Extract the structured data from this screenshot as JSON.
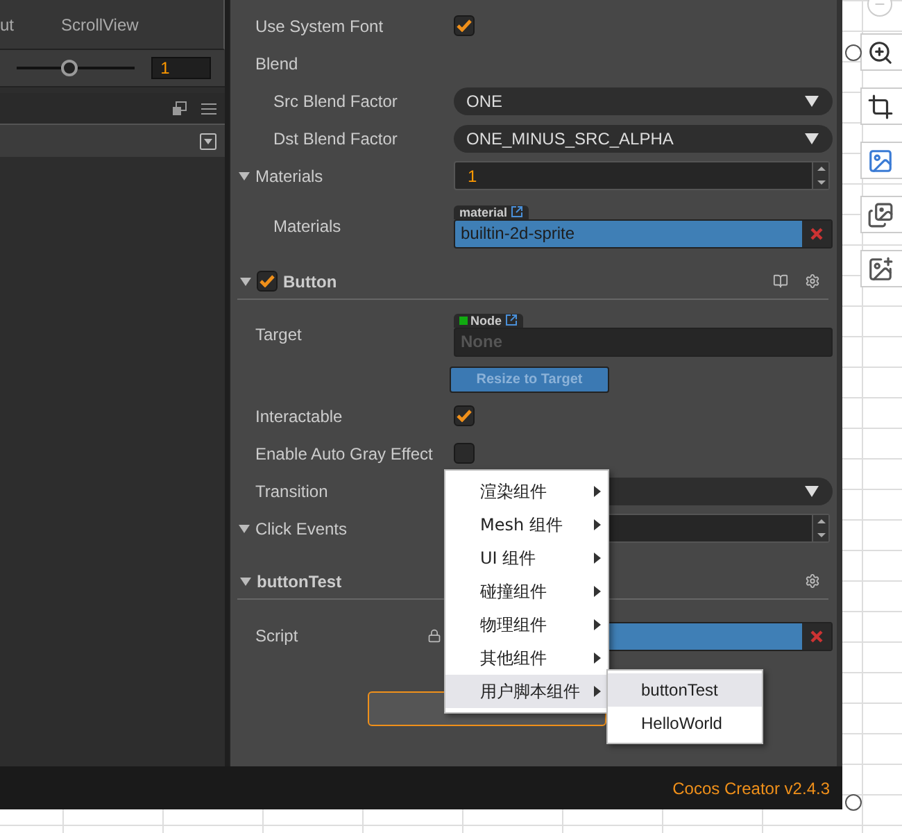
{
  "left_panel": {
    "tabs": [
      {
        "label": "ut",
        "selected": false
      },
      {
        "label": "ScrollView",
        "selected": false
      }
    ],
    "zoom_slider": {
      "level": 0.45
    },
    "zoom_value": "1"
  },
  "inspector": {
    "properties": [
      {
        "kind": "check",
        "label": "Use System Font",
        "checked": true
      },
      {
        "kind": "group",
        "label": "Blend",
        "children": [
          {
            "kind": "select",
            "label": "Src Blend Factor",
            "value": "ONE"
          },
          {
            "kind": "select",
            "label": "Dst Blend Factor",
            "value": "ONE_MINUS_SRC_ALPHA"
          }
        ]
      },
      {
        "kind": "number",
        "label": "Materials",
        "value": "1",
        "expanded": true,
        "children": [
          {
            "kind": "asset",
            "label": "Materials",
            "tag": "material",
            "value": "builtin-2d-sprite"
          }
        ]
      }
    ],
    "components": [
      {
        "name": "Button",
        "enabled": true,
        "expanded": true,
        "properties": [
          {
            "kind": "node",
            "label": "Target",
            "tag": "Node",
            "placeholder": "None"
          },
          {
            "kind": "action",
            "label": "Resize to Target",
            "disabled": true
          },
          {
            "kind": "check",
            "label": "Interactable",
            "checked": true
          },
          {
            "kind": "check",
            "label": "Enable Auto Gray Effect",
            "checked": false
          },
          {
            "kind": "select",
            "label": "Transition"
          },
          {
            "kind": "number",
            "label": "Click Events",
            "expanded": true
          }
        ]
      },
      {
        "name": "buttonTest",
        "expanded": true,
        "properties": [
          {
            "kind": "script",
            "label": "Script"
          }
        ]
      }
    ]
  },
  "context_menu": {
    "items": [
      {
        "label": "渲染组件",
        "selected": false
      },
      {
        "label": "Mesh 组件",
        "selected": false
      },
      {
        "label": "UI 组件",
        "selected": false
      },
      {
        "label": "碰撞组件",
        "selected": false
      },
      {
        "label": "物理组件",
        "selected": false
      },
      {
        "label": "其他组件",
        "selected": false
      },
      {
        "label": "用户脚本组件",
        "selected": true
      }
    ],
    "submenu": [
      {
        "label": "buttonTest",
        "selected": true
      },
      {
        "label": "HelloWorld",
        "selected": false
      }
    ]
  },
  "status_bar": "Cocos Creator v2.4.3"
}
